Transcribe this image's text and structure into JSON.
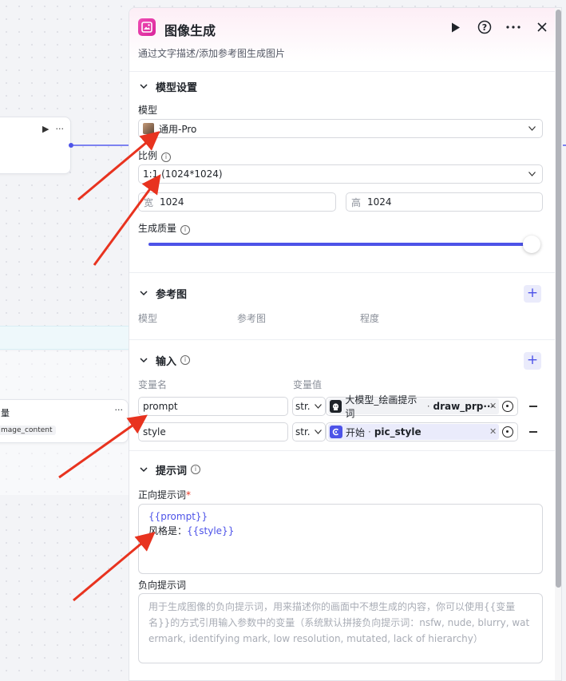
{
  "canvas": {
    "node_mid_title": "量",
    "node_mid_tag": "mage_content"
  },
  "panel": {
    "title": "图像生成",
    "subtitle": "通过文字描述/添加参考图生成图片"
  },
  "model_section": {
    "title": "模型设置",
    "model_label": "模型",
    "model_value": "通用-Pro",
    "ratio_label": "比例",
    "ratio_value": "1:1 (1024*1024)",
    "width_label": "宽",
    "width_value": "1024",
    "height_label": "高",
    "height_value": "1024",
    "quality_label": "生成质量",
    "quality_level": 1.0
  },
  "reference_section": {
    "title": "参考图",
    "columns": [
      "模型",
      "参考图",
      "程度"
    ]
  },
  "input_section": {
    "title": "输入",
    "col_name": "变量名",
    "col_value": "变量值",
    "rows": [
      {
        "name": "prompt",
        "type": "str.",
        "source_icon": "bot-icon",
        "source": "大模型_绘画提示词",
        "var": "draw_prp···"
      },
      {
        "name": "style",
        "type": "str.",
        "source_icon": "start-icon",
        "source": "开始",
        "var": "pic_style"
      }
    ]
  },
  "prompt_section": {
    "title": "提示词",
    "positive_label": "正向提示词",
    "required_mark": "*",
    "positive_line1": "{{prompt}}",
    "positive_line2_prefix": "风格是：",
    "positive_line2_var": "{{style}}",
    "negative_label": "负向提示词",
    "negative_placeholder": "用于生成图像的负向提示词，用来描述你的画面中不想生成的内容，你可以使用{{变量名}}的方式引用输入参数中的变量（系统默认拼接负向提示词：nsfw, nude, blurry, watermark, identifying mark, low resolution, mutated, lack of hierarchy）"
  },
  "colors": {
    "accent": "#4d53e8",
    "brand_pink": "#e0309f",
    "annotation_arrow": "#e8331f"
  }
}
